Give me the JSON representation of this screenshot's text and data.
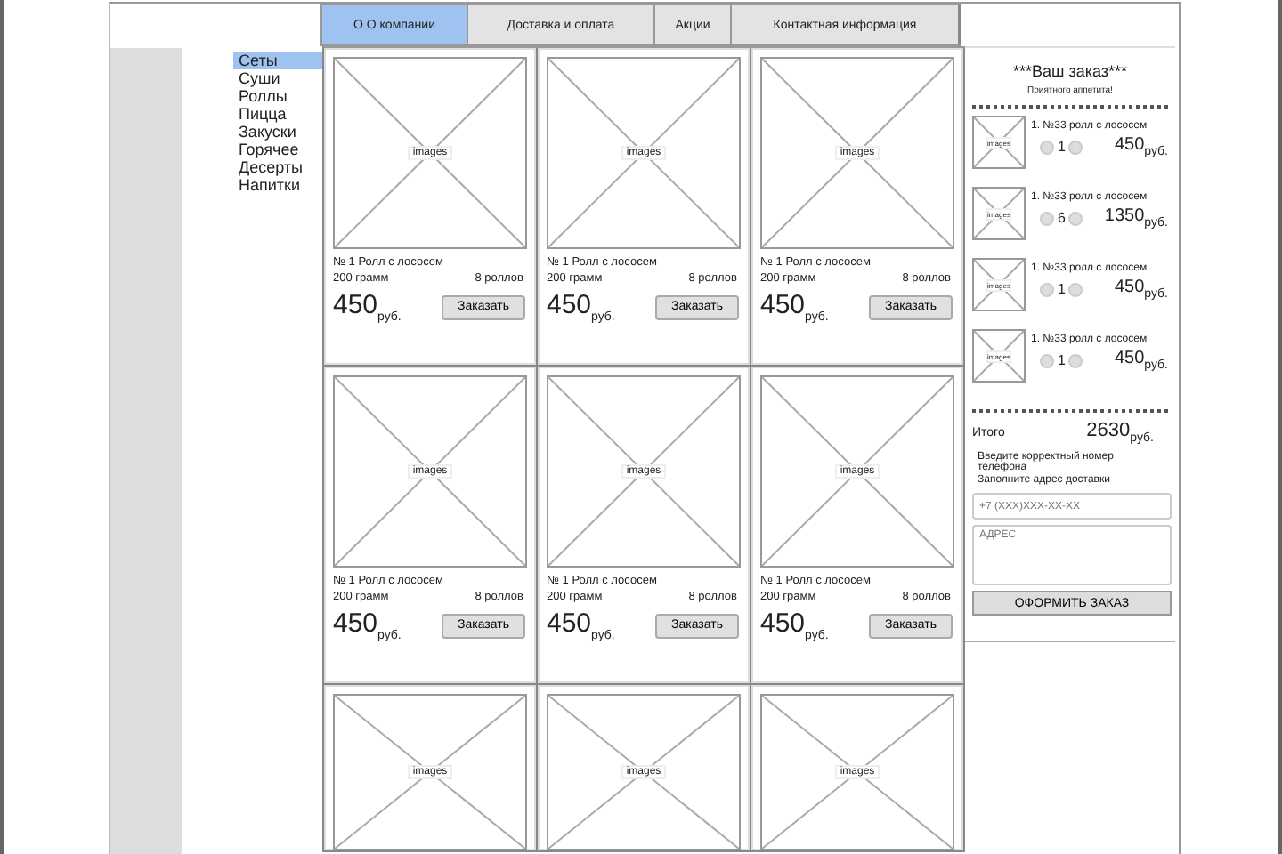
{
  "nav_tabs": [
    {
      "label": "О О компании",
      "selected": true
    },
    {
      "label": "Доставка и оплата",
      "selected": false
    },
    {
      "label": "Акции",
      "selected": false
    },
    {
      "label": "Контактная информация",
      "selected": false
    }
  ],
  "categories": [
    {
      "label": "Сеты",
      "selected": true
    },
    {
      "label": "Суши",
      "selected": false
    },
    {
      "label": "Роллы",
      "selected": false
    },
    {
      "label": "Пицца",
      "selected": false
    },
    {
      "label": "Закуски",
      "selected": false
    },
    {
      "label": "Горячее",
      "selected": false
    },
    {
      "label": "Десерты",
      "selected": false
    },
    {
      "label": "Напитки",
      "selected": false
    }
  ],
  "products": [
    {
      "kind": "full",
      "image_label": "images",
      "name": "№ 1 Ролл с лососем",
      "weight": "200 грамм",
      "pieces": "8 роллов",
      "price": "450",
      "currency": "руб.",
      "button": "Заказать"
    },
    {
      "kind": "full",
      "image_label": "images",
      "name": "№ 1 Ролл с лососем",
      "weight": "200 грамм",
      "pieces": "8 роллов",
      "price": "450",
      "currency": "руб.",
      "button": "Заказать"
    },
    {
      "kind": "full",
      "image_label": "images",
      "name": "№ 1 Ролл с лососем",
      "weight": "200 грамм",
      "pieces": "8 роллов",
      "price": "450",
      "currency": "руб.",
      "button": "Заказать"
    },
    {
      "kind": "full",
      "image_label": "images",
      "name": "№ 1 Ролл с лососем",
      "weight": "200 грамм",
      "pieces": "8 роллов",
      "price": "450",
      "currency": "руб.",
      "button": "Заказать"
    },
    {
      "kind": "full",
      "image_label": "images",
      "name": "№ 1 Ролл с лососем",
      "weight": "200 грамм",
      "pieces": "8 роллов",
      "price": "450",
      "currency": "руб.",
      "button": "Заказать"
    },
    {
      "kind": "full",
      "image_label": "images",
      "name": "№ 1 Ролл с лососем",
      "weight": "200 грамм",
      "pieces": "8 роллов",
      "price": "450",
      "currency": "руб.",
      "button": "Заказать"
    },
    {
      "kind": "cut",
      "image_label": "images"
    },
    {
      "kind": "cut",
      "image_label": "images"
    },
    {
      "kind": "cut",
      "image_label": "images"
    }
  ],
  "order": {
    "title": "***Ваш заказ***",
    "subtitle": "Приятного аппетита!",
    "items": [
      {
        "image_label": "images",
        "name": "1. №33 ролл с лососем",
        "quantity": "1",
        "price": "450",
        "currency": "руб."
      },
      {
        "image_label": "images",
        "name": "1. №33 ролл с лососем",
        "quantity": "6",
        "price": "1350",
        "currency": "руб."
      },
      {
        "image_label": "images",
        "name": "1. №33 ролл с лососем",
        "quantity": "1",
        "price": "450",
        "currency": "руб."
      },
      {
        "image_label": "images",
        "name": "1. №33 ролл с лососем",
        "quantity": "1",
        "price": "450",
        "currency": "руб."
      }
    ],
    "total_label": "Итого",
    "total": "2630",
    "total_currency": "руб.",
    "hint_phone": "Введите корректный номер телефона",
    "hint_address": "Заполните адрес доставки",
    "phone_placeholder": "+7 (XXX)XXX-XX-XX",
    "address_placeholder": "АДРЕС",
    "submit": "ОФОРМИТЬ ЗАКАЗ"
  }
}
